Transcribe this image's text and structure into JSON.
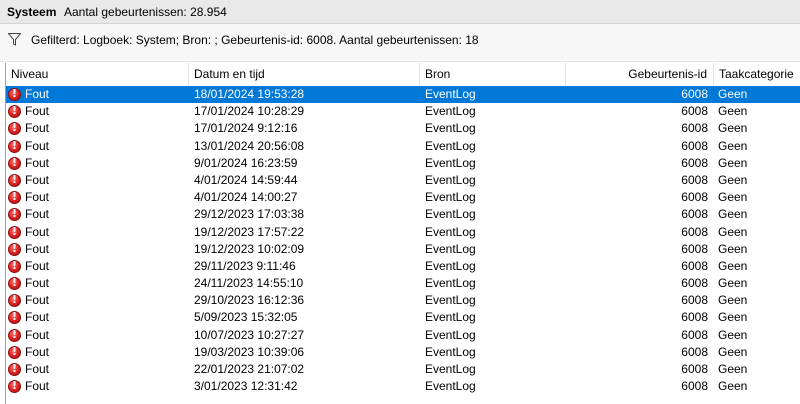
{
  "titlebar": {
    "title": "Systeem",
    "count": "Aantal gebeurtenissen: 28.954"
  },
  "filter": {
    "icon": "funnel-icon",
    "text": "Gefilterd: Logboek: System; Bron: ; Gebeurtenis-id: 6008. Aantal gebeurtenissen: 18"
  },
  "columns": {
    "level": "Niveau",
    "date": "Datum en tijd",
    "source": "Bron",
    "id": "Gebeurtenis-id",
    "category": "Taakcategorie"
  },
  "colors": {
    "selection": "#0078d7",
    "error_icon": "#d9201e"
  },
  "rows": [
    {
      "level": "Fout",
      "date": "18/01/2024 19:53:28",
      "source": "EventLog",
      "id": "6008",
      "category": "Geen"
    },
    {
      "level": "Fout",
      "date": "17/01/2024 10:28:29",
      "source": "EventLog",
      "id": "6008",
      "category": "Geen"
    },
    {
      "level": "Fout",
      "date": "17/01/2024 9:12:16",
      "source": "EventLog",
      "id": "6008",
      "category": "Geen"
    },
    {
      "level": "Fout",
      "date": "13/01/2024 20:56:08",
      "source": "EventLog",
      "id": "6008",
      "category": "Geen"
    },
    {
      "level": "Fout",
      "date": "9/01/2024 16:23:59",
      "source": "EventLog",
      "id": "6008",
      "category": "Geen"
    },
    {
      "level": "Fout",
      "date": "4/01/2024 14:59:44",
      "source": "EventLog",
      "id": "6008",
      "category": "Geen"
    },
    {
      "level": "Fout",
      "date": "4/01/2024 14:00:27",
      "source": "EventLog",
      "id": "6008",
      "category": "Geen"
    },
    {
      "level": "Fout",
      "date": "29/12/2023 17:03:38",
      "source": "EventLog",
      "id": "6008",
      "category": "Geen"
    },
    {
      "level": "Fout",
      "date": "19/12/2023 17:57:22",
      "source": "EventLog",
      "id": "6008",
      "category": "Geen"
    },
    {
      "level": "Fout",
      "date": "19/12/2023 10:02:09",
      "source": "EventLog",
      "id": "6008",
      "category": "Geen"
    },
    {
      "level": "Fout",
      "date": "29/11/2023 9:11:46",
      "source": "EventLog",
      "id": "6008",
      "category": "Geen"
    },
    {
      "level": "Fout",
      "date": "24/11/2023 14:55:10",
      "source": "EventLog",
      "id": "6008",
      "category": "Geen"
    },
    {
      "level": "Fout",
      "date": "29/10/2023 16:12:36",
      "source": "EventLog",
      "id": "6008",
      "category": "Geen"
    },
    {
      "level": "Fout",
      "date": "5/09/2023 15:32:05",
      "source": "EventLog",
      "id": "6008",
      "category": "Geen"
    },
    {
      "level": "Fout",
      "date": "10/07/2023 10:27:27",
      "source": "EventLog",
      "id": "6008",
      "category": "Geen"
    },
    {
      "level": "Fout",
      "date": "19/03/2023 10:39:06",
      "source": "EventLog",
      "id": "6008",
      "category": "Geen"
    },
    {
      "level": "Fout",
      "date": "22/01/2023 21:07:02",
      "source": "EventLog",
      "id": "6008",
      "category": "Geen"
    },
    {
      "level": "Fout",
      "date": "3/01/2023 12:31:42",
      "source": "EventLog",
      "id": "6008",
      "category": "Geen"
    }
  ]
}
